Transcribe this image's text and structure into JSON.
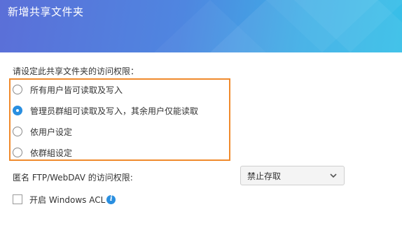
{
  "header": {
    "title": "新增共享文件夹"
  },
  "access": {
    "prompt": "请设定此共享文件夹的访问权限：",
    "options": [
      {
        "label": "所有用户皆可读取及写入",
        "checked": false
      },
      {
        "label": "管理员群組可读取及写入，其余用户仅能读取",
        "checked": true
      },
      {
        "label": "依用户设定",
        "checked": false
      },
      {
        "label": "依群組设定",
        "checked": false
      }
    ]
  },
  "ftp": {
    "label": "匿名 FTP/WebDAV 的访问权限:",
    "selected": "禁止存取"
  },
  "acl": {
    "label": "开启 Windows ACL",
    "checked": false,
    "info_icon": "info-icon"
  },
  "colors": {
    "accent": "#2a8fe0",
    "highlight_border": "#f08a2c"
  }
}
